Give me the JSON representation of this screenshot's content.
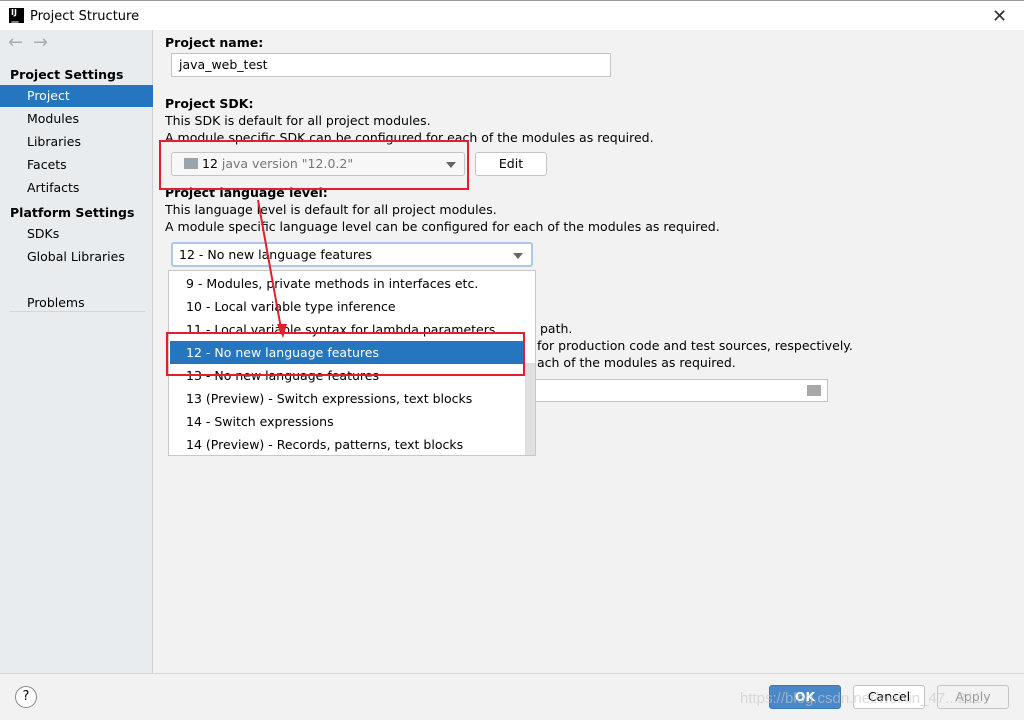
{
  "window": {
    "title": "Project Structure",
    "app_icon": "intellij-icon",
    "close_icon": "close-icon"
  },
  "sidebar": {
    "back_icon": "arrow-left-icon",
    "forward_icon": "arrow-right-icon",
    "project_settings_label": "Project Settings",
    "project_settings_items": [
      {
        "label": "Project",
        "selected": true
      },
      {
        "label": "Modules"
      },
      {
        "label": "Libraries"
      },
      {
        "label": "Facets"
      },
      {
        "label": "Artifacts"
      }
    ],
    "platform_settings_label": "Platform Settings",
    "platform_settings_items": [
      {
        "label": "SDKs"
      },
      {
        "label": "Global Libraries"
      }
    ],
    "problems_label": "Problems"
  },
  "main": {
    "project_name_label": "Project name:",
    "project_name_value": "java_web_test",
    "sdk_label": "Project SDK:",
    "sdk_desc1": "This SDK is default for all project modules.",
    "sdk_desc2": "A module specific SDK can be configured for each of the modules as required.",
    "sdk_version": "12",
    "sdk_name": "java version \"12.0.2\"",
    "edit_button": "Edit",
    "lang_label": "Project language level:",
    "lang_desc1": "This language level is default for all project modules.",
    "lang_desc2": "A module specific language level can be configured for each of the modules as required.",
    "lang_value": "12 - No new language features",
    "compiler_fragment1": "path.",
    "compiler_fragment2": "for production code and test sources, respectively.",
    "compiler_fragment3": "ach of the modules as required.",
    "folder_icon": "folder-icon"
  },
  "dropdown": {
    "options": [
      {
        "label": "9 - Modules, private methods in interfaces etc."
      },
      {
        "label": "10 - Local variable type inference"
      },
      {
        "label": "11 - Local variable syntax for lambda parameters"
      },
      {
        "label": "12 - No new language features",
        "selected": true
      },
      {
        "label": "13 - No new language features"
      },
      {
        "label": "13 (Preview) - Switch expressions, text blocks"
      },
      {
        "label": "14 - Switch expressions"
      },
      {
        "label": "14 (Preview) - Records, patterns, text blocks"
      }
    ]
  },
  "footer": {
    "help": "?",
    "ok": "OK",
    "cancel": "Cancel",
    "apply": "Apply"
  },
  "watermark": "https://blog.csdn.net/weixin_47...211",
  "colors": {
    "selection": "#2675bf",
    "annotation": "#e0202a"
  }
}
